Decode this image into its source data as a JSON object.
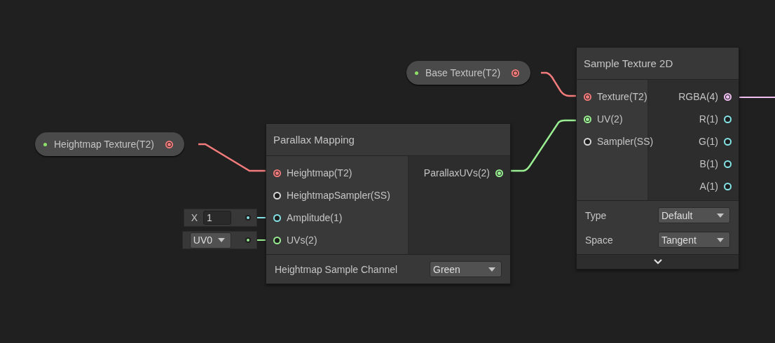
{
  "properties": [
    {
      "label": "Heightmap Texture(T2)",
      "exposed": true,
      "port": {
        "color": "#f27b7b",
        "connected": true
      }
    },
    {
      "label": "Base Texture(T2)",
      "exposed": true,
      "port": {
        "color": "#f27b7b",
        "connected": true
      }
    }
  ],
  "nodes": [
    {
      "title": "Parallax Mapping",
      "inputs": [
        {
          "label": "Heightmap(T2)",
          "color": "#f27b7b",
          "connected": true
        },
        {
          "label": "HeightmapSampler(SS)",
          "color": "#d8d8d8",
          "connected": false
        },
        {
          "label": "Amplitude(1)",
          "color": "#84e4e7",
          "connected": false,
          "inline": {
            "kind": "number",
            "axis": "X",
            "value": "1"
          }
        },
        {
          "label": "UVs(2)",
          "color": "#9aef92",
          "connected": false,
          "inline": {
            "kind": "dropdown",
            "value": "UV0"
          }
        }
      ],
      "outputs": [
        {
          "label": "ParallaxUVs(2)",
          "color": "#9aef92",
          "connected": true
        }
      ],
      "controls": [
        {
          "label": "Heightmap Sample Channel",
          "value": "Green"
        }
      ],
      "collapsible": false
    },
    {
      "title": "Sample Texture 2D",
      "inputs": [
        {
          "label": "Texture(T2)",
          "color": "#f27b7b",
          "connected": true
        },
        {
          "label": "UV(2)",
          "color": "#9aef92",
          "connected": true
        },
        {
          "label": "Sampler(SS)",
          "color": "#d8d8d8",
          "connected": false
        }
      ],
      "outputs": [
        {
          "label": "RGBA(4)",
          "color": "#f1c0f2",
          "connected": true
        },
        {
          "label": "R(1)",
          "color": "#84e4e7",
          "connected": false
        },
        {
          "label": "G(1)",
          "color": "#84e4e7",
          "connected": false
        },
        {
          "label": "B(1)",
          "color": "#84e4e7",
          "connected": false
        },
        {
          "label": "A(1)",
          "color": "#84e4e7",
          "connected": false
        }
      ],
      "controls": [
        {
          "label": "Type",
          "value": "Default"
        },
        {
          "label": "Space",
          "value": "Tangent"
        }
      ],
      "collapsible": true
    }
  ]
}
